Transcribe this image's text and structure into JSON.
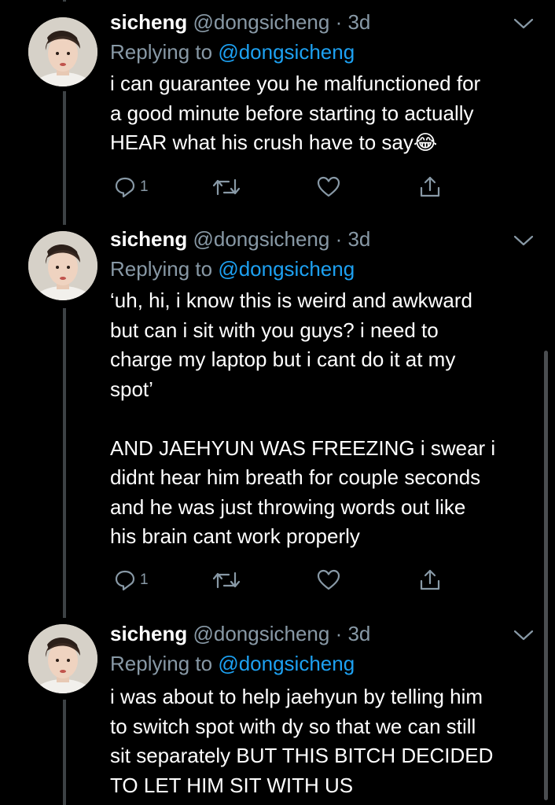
{
  "tweets": [
    {
      "name": "sicheng",
      "handle": "@dongsicheng",
      "time": "· 3d",
      "replying_label": "Replying to",
      "replying_to": "@dongsicheng",
      "text": "i can guarantee you he malfunctioned for\na good minute before starting to actually\nHEAR what his crush have to say😂",
      "reply_count": "1"
    },
    {
      "name": "sicheng",
      "handle": "@dongsicheng",
      "time": "· 3d",
      "replying_label": "Replying to",
      "replying_to": "@dongsicheng",
      "text": "‘uh, hi, i know this is weird and awkward\nbut can i sit with you guys? i need to\ncharge my laptop but i cant do it at my\nspot’\n\nAND JAEHYUN WAS FREEZING i swear i\ndidnt hear him breath for couple seconds\nand he was just throwing words out like\nhis brain cant work properly",
      "reply_count": "1"
    },
    {
      "name": "sicheng",
      "handle": "@dongsicheng",
      "time": "· 3d",
      "replying_label": "Replying to",
      "replying_to": "@dongsicheng",
      "text": "i was about to help jaehyun by telling him\nto switch spot with dy so that we can still\nsit separately BUT THIS BITCH DECIDED\nTO LET HIM SIT WITH US",
      "reply_count": ""
    }
  ],
  "icons": {
    "reply": "reply-icon",
    "retweet": "retweet-icon",
    "like": "heart-icon",
    "share": "share-icon",
    "menu": "chevron-down-icon"
  },
  "colors": {
    "background": "#000000",
    "text": "#ffffff",
    "secondary": "#8899a6",
    "link": "#1da1f2",
    "thread_line": "#3d4245"
  }
}
